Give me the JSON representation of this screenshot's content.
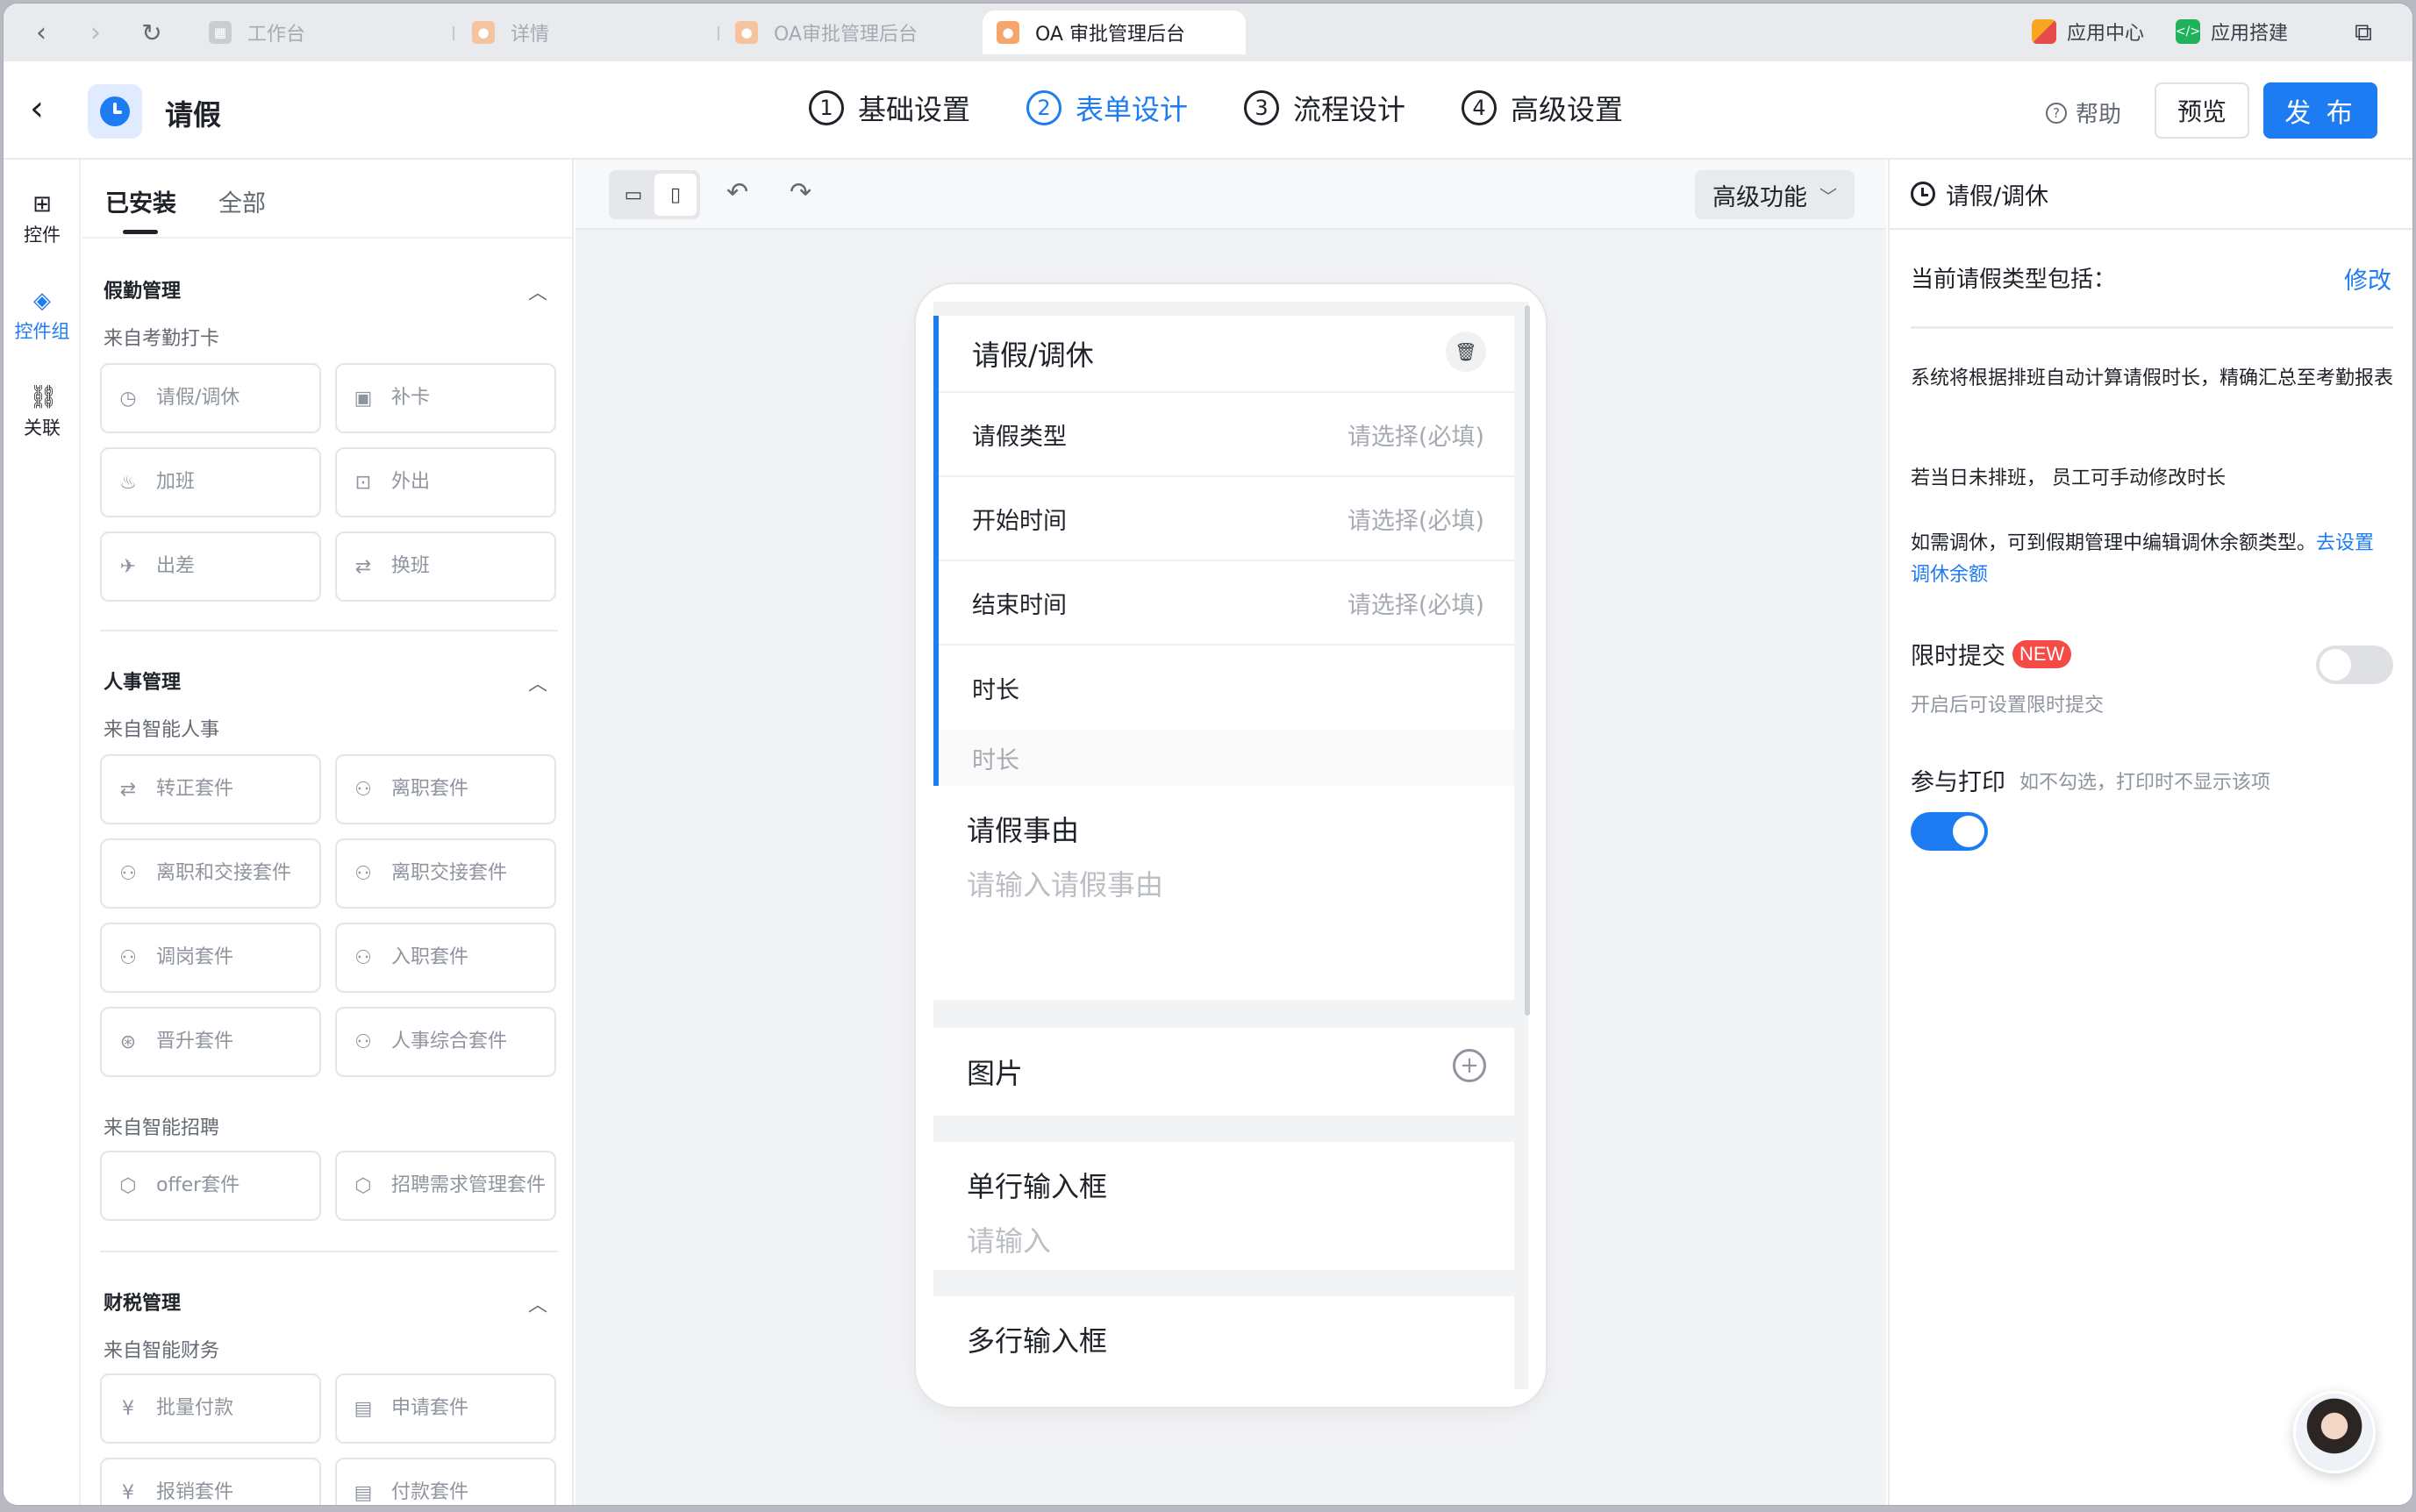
{
  "browser": {
    "tabs": [
      {
        "label": "工作台",
        "active": false
      },
      {
        "label": "详情",
        "active": false
      },
      {
        "label": "OA审批管理后台",
        "active": false
      },
      {
        "label": "OA 审批管理后台",
        "active": true
      }
    ],
    "right_items": [
      "应用中心",
      "应用搭建"
    ]
  },
  "header": {
    "title": "请假",
    "steps": [
      {
        "num": "1",
        "label": "基础设置"
      },
      {
        "num": "2",
        "label": "表单设计"
      },
      {
        "num": "3",
        "label": "流程设计"
      },
      {
        "num": "4",
        "label": "高级设置"
      }
    ],
    "active_step": 2,
    "help": "帮助",
    "preview": "预览",
    "publish": "发 布",
    "accent": "#1e7cf2"
  },
  "rail": [
    {
      "label": "控件",
      "icon": "grid-icon"
    },
    {
      "label": "控件组",
      "icon": "layers-icon"
    },
    {
      "label": "关联",
      "icon": "link-icon"
    }
  ],
  "widgets": {
    "tabs": [
      "已安装",
      "全部"
    ],
    "sections": [
      {
        "title": "假勤管理",
        "source": "来自考勤打卡",
        "items": [
          "请假/调休",
          "补卡",
          "加班",
          "外出",
          "出差",
          "换班"
        ]
      },
      {
        "title": "人事管理",
        "source": "来自智能人事",
        "items": [
          "转正套件",
          "离职套件",
          "离职和交接套件",
          "离职交接套件",
          "调岗套件",
          "入职套件",
          "晋升套件",
          "人事综合套件"
        ],
        "source2": "来自智能招聘",
        "items2": [
          "offer套件",
          "招聘需求管理套件"
        ]
      },
      {
        "title": "财税管理",
        "source": "来自智能财务",
        "items": [
          "批量付款",
          "申请套件",
          "报销套件",
          "付款套件"
        ]
      }
    ]
  },
  "canvas": {
    "advanced": "高级功能",
    "group_title": "请假/调休",
    "rows": [
      {
        "label": "请假类型",
        "placeholder": "请选择(必填)"
      },
      {
        "label": "开始时间",
        "placeholder": "请选择(必填)"
      },
      {
        "label": "结束时间",
        "placeholder": "请选择(必填)"
      }
    ],
    "duration_label": "时长",
    "duration_placeholder": "时长",
    "reason_label": "请假事由",
    "reason_placeholder": "请输入请假事由",
    "image_label": "图片",
    "single_label": "单行输入框",
    "single_placeholder": "请输入",
    "multi_label": "多行输入框"
  },
  "props": {
    "title": "请假/调休",
    "types_label": "当前请假类型包括：",
    "edit": "修改",
    "note1": "系统将根据排班自动计算请假时长，精确汇总至考勤报表",
    "note2": "若当日未排班， 员工可手动修改时长",
    "note3": "如需调休，可到假期管理中编辑调休余额类型。",
    "note3_link": "去设置调休余额",
    "limit_label": "限时提交",
    "limit_badge": "NEW",
    "limit_desc": "开启后可设置限时提交",
    "limit_on": false,
    "print_label": "参与打印",
    "print_hint": "如不勾选，打印时不显示该项",
    "print_on": true
  }
}
